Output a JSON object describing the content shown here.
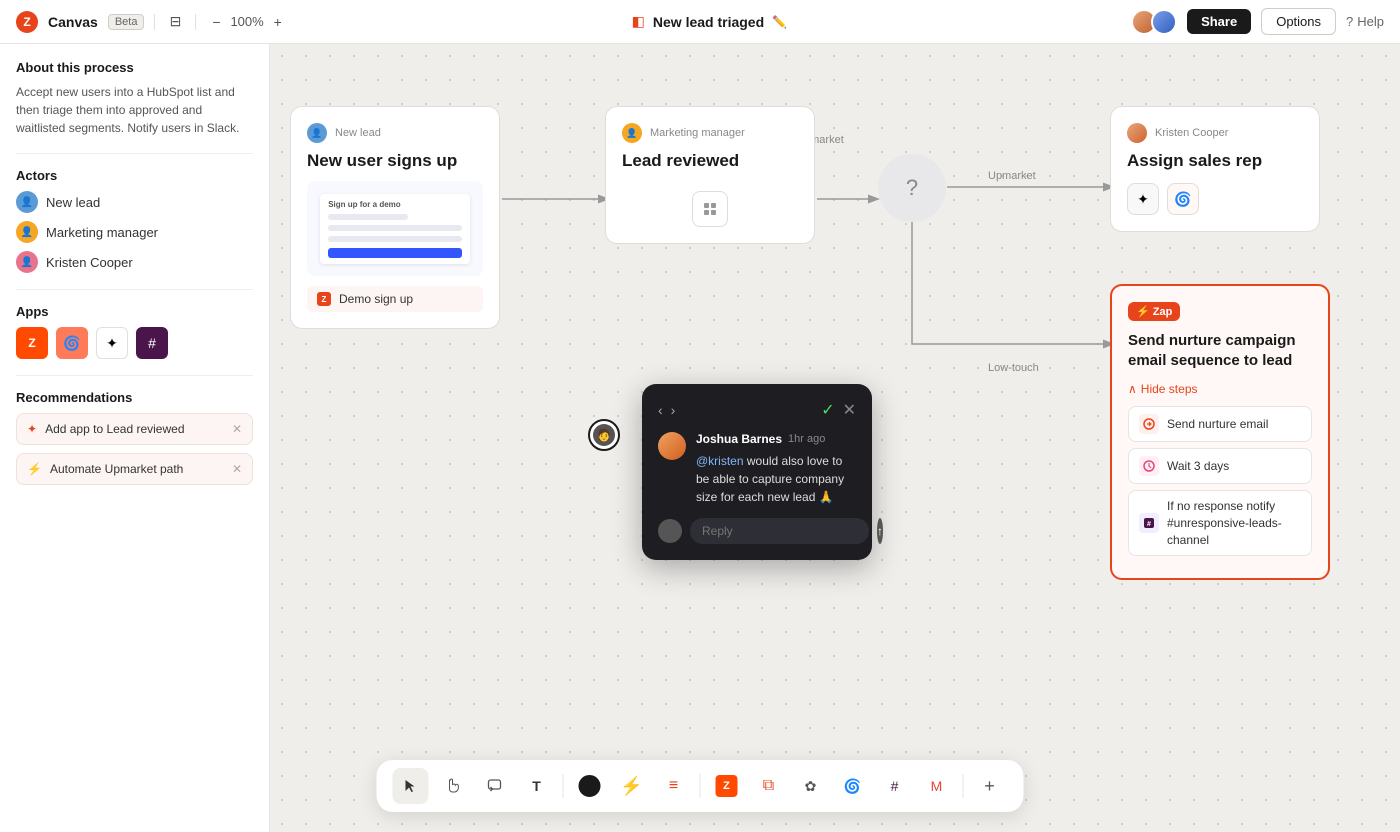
{
  "topbar": {
    "logo": "Z",
    "app_name": "Canvas",
    "badge": "Beta",
    "zoom": "100%",
    "title": "New lead triaged",
    "share_label": "Share",
    "options_label": "Options",
    "help_label": "Help"
  },
  "sidebar": {
    "process_title": "About this process",
    "process_desc": "Accept new users into a HubSpot list and then triage them into approved and waitlisted segments. Notify users in Slack.",
    "actors_title": "Actors",
    "actors": [
      {
        "name": "New lead",
        "color": "blue"
      },
      {
        "name": "Marketing manager",
        "color": "yellow"
      },
      {
        "name": "Kristen Cooper",
        "color": "pink"
      }
    ],
    "apps_title": "Apps",
    "recommendations_title": "Recommendations",
    "recs": [
      {
        "label": "Add app to Lead reviewed"
      },
      {
        "label": "Automate Upmarket path"
      }
    ]
  },
  "nodes": {
    "signup": {
      "actor": "New lead",
      "title": "New user signs up",
      "app_label": "Demo sign up"
    },
    "reviewed": {
      "actor": "Marketing manager",
      "title": "Lead reviewed"
    },
    "decision": {
      "label": "Is customer upmarket",
      "upmarket_edge": "Upmarket",
      "lowtouch_edge": "Low-touch"
    },
    "assign": {
      "actor": "Kristen Cooper",
      "title": "Assign sales rep"
    },
    "zap": {
      "badge": "⚡ Zap",
      "title": "Send nurture campaign email sequence to lead",
      "toggle": "Hide steps",
      "steps": [
        {
          "label": "Send nurture email"
        },
        {
          "label": "Wait 3 days"
        },
        {
          "label": "If no response notify #unresponsive-leads-channel"
        }
      ]
    }
  },
  "comment": {
    "author": "Joshua Barnes",
    "time": "1hr ago",
    "text_before": "",
    "mention": "@kristen",
    "text_after": " would also love to be able to capture company size for each new lead 🙏",
    "reply_placeholder": "Reply"
  },
  "toolbar": {
    "buttons": [
      "cursor",
      "hand",
      "comment",
      "text",
      "circle",
      "zap",
      "layers",
      "zapier",
      "frame",
      "openai",
      "hubspot",
      "slack",
      "gmail",
      "plus"
    ]
  }
}
